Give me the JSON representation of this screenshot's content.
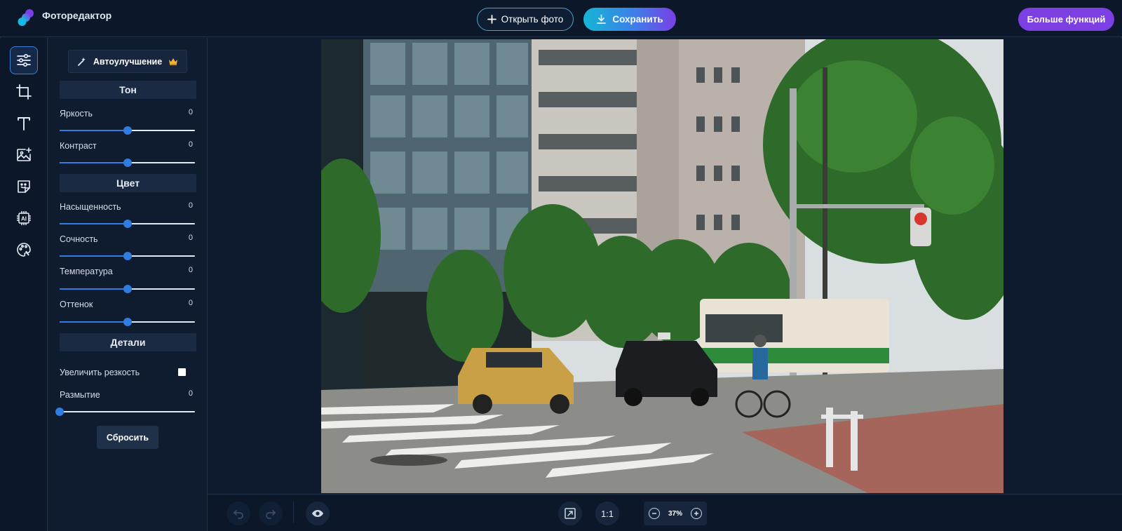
{
  "header": {
    "app_title": "Фоторедактор",
    "open_photo_label": "Открыть фото",
    "save_label": "Сохранить",
    "more_features_label": "Больше функций"
  },
  "rail": {
    "items": [
      {
        "icon": "adjustments-icon",
        "active": true
      },
      {
        "icon": "crop-icon",
        "active": false
      },
      {
        "icon": "text-icon",
        "active": false
      },
      {
        "icon": "add-image-icon",
        "active": false
      },
      {
        "icon": "sticker-icon",
        "active": false
      },
      {
        "icon": "ai-chip-icon",
        "active": false
      },
      {
        "icon": "palette-icon",
        "active": false
      }
    ]
  },
  "panel": {
    "auto_enhance_label": "Автоулучшение",
    "sections": {
      "tone": "Тон",
      "color": "Цвет",
      "details": "Детали"
    },
    "sliders": {
      "brightness": {
        "label": "Яркость",
        "value": "0",
        "level": 0.5
      },
      "contrast": {
        "label": "Контраст",
        "value": "0",
        "level": 0.5
      },
      "saturation": {
        "label": "Насыщенность",
        "value": "0",
        "level": 0.5
      },
      "vibrance": {
        "label": "Сочность",
        "value": "0",
        "level": 0.5
      },
      "temperature": {
        "label": "Температура",
        "value": "0",
        "level": 0.5
      },
      "tint": {
        "label": "Оттенок",
        "value": "0",
        "level": 0.5
      },
      "blur": {
        "label": "Размытие",
        "value": "0",
        "level": 0
      }
    },
    "sharpen_label": "Увеличить резкость",
    "sharpen_checked": false,
    "reset_label": "Сбросить"
  },
  "bottom": {
    "one_to_one_label": "1:1",
    "zoom_value": "37%"
  },
  "colors": {
    "accent_blue": "#2f7de0",
    "purple": "#7b3fe2",
    "background": "#0e1a2d"
  }
}
